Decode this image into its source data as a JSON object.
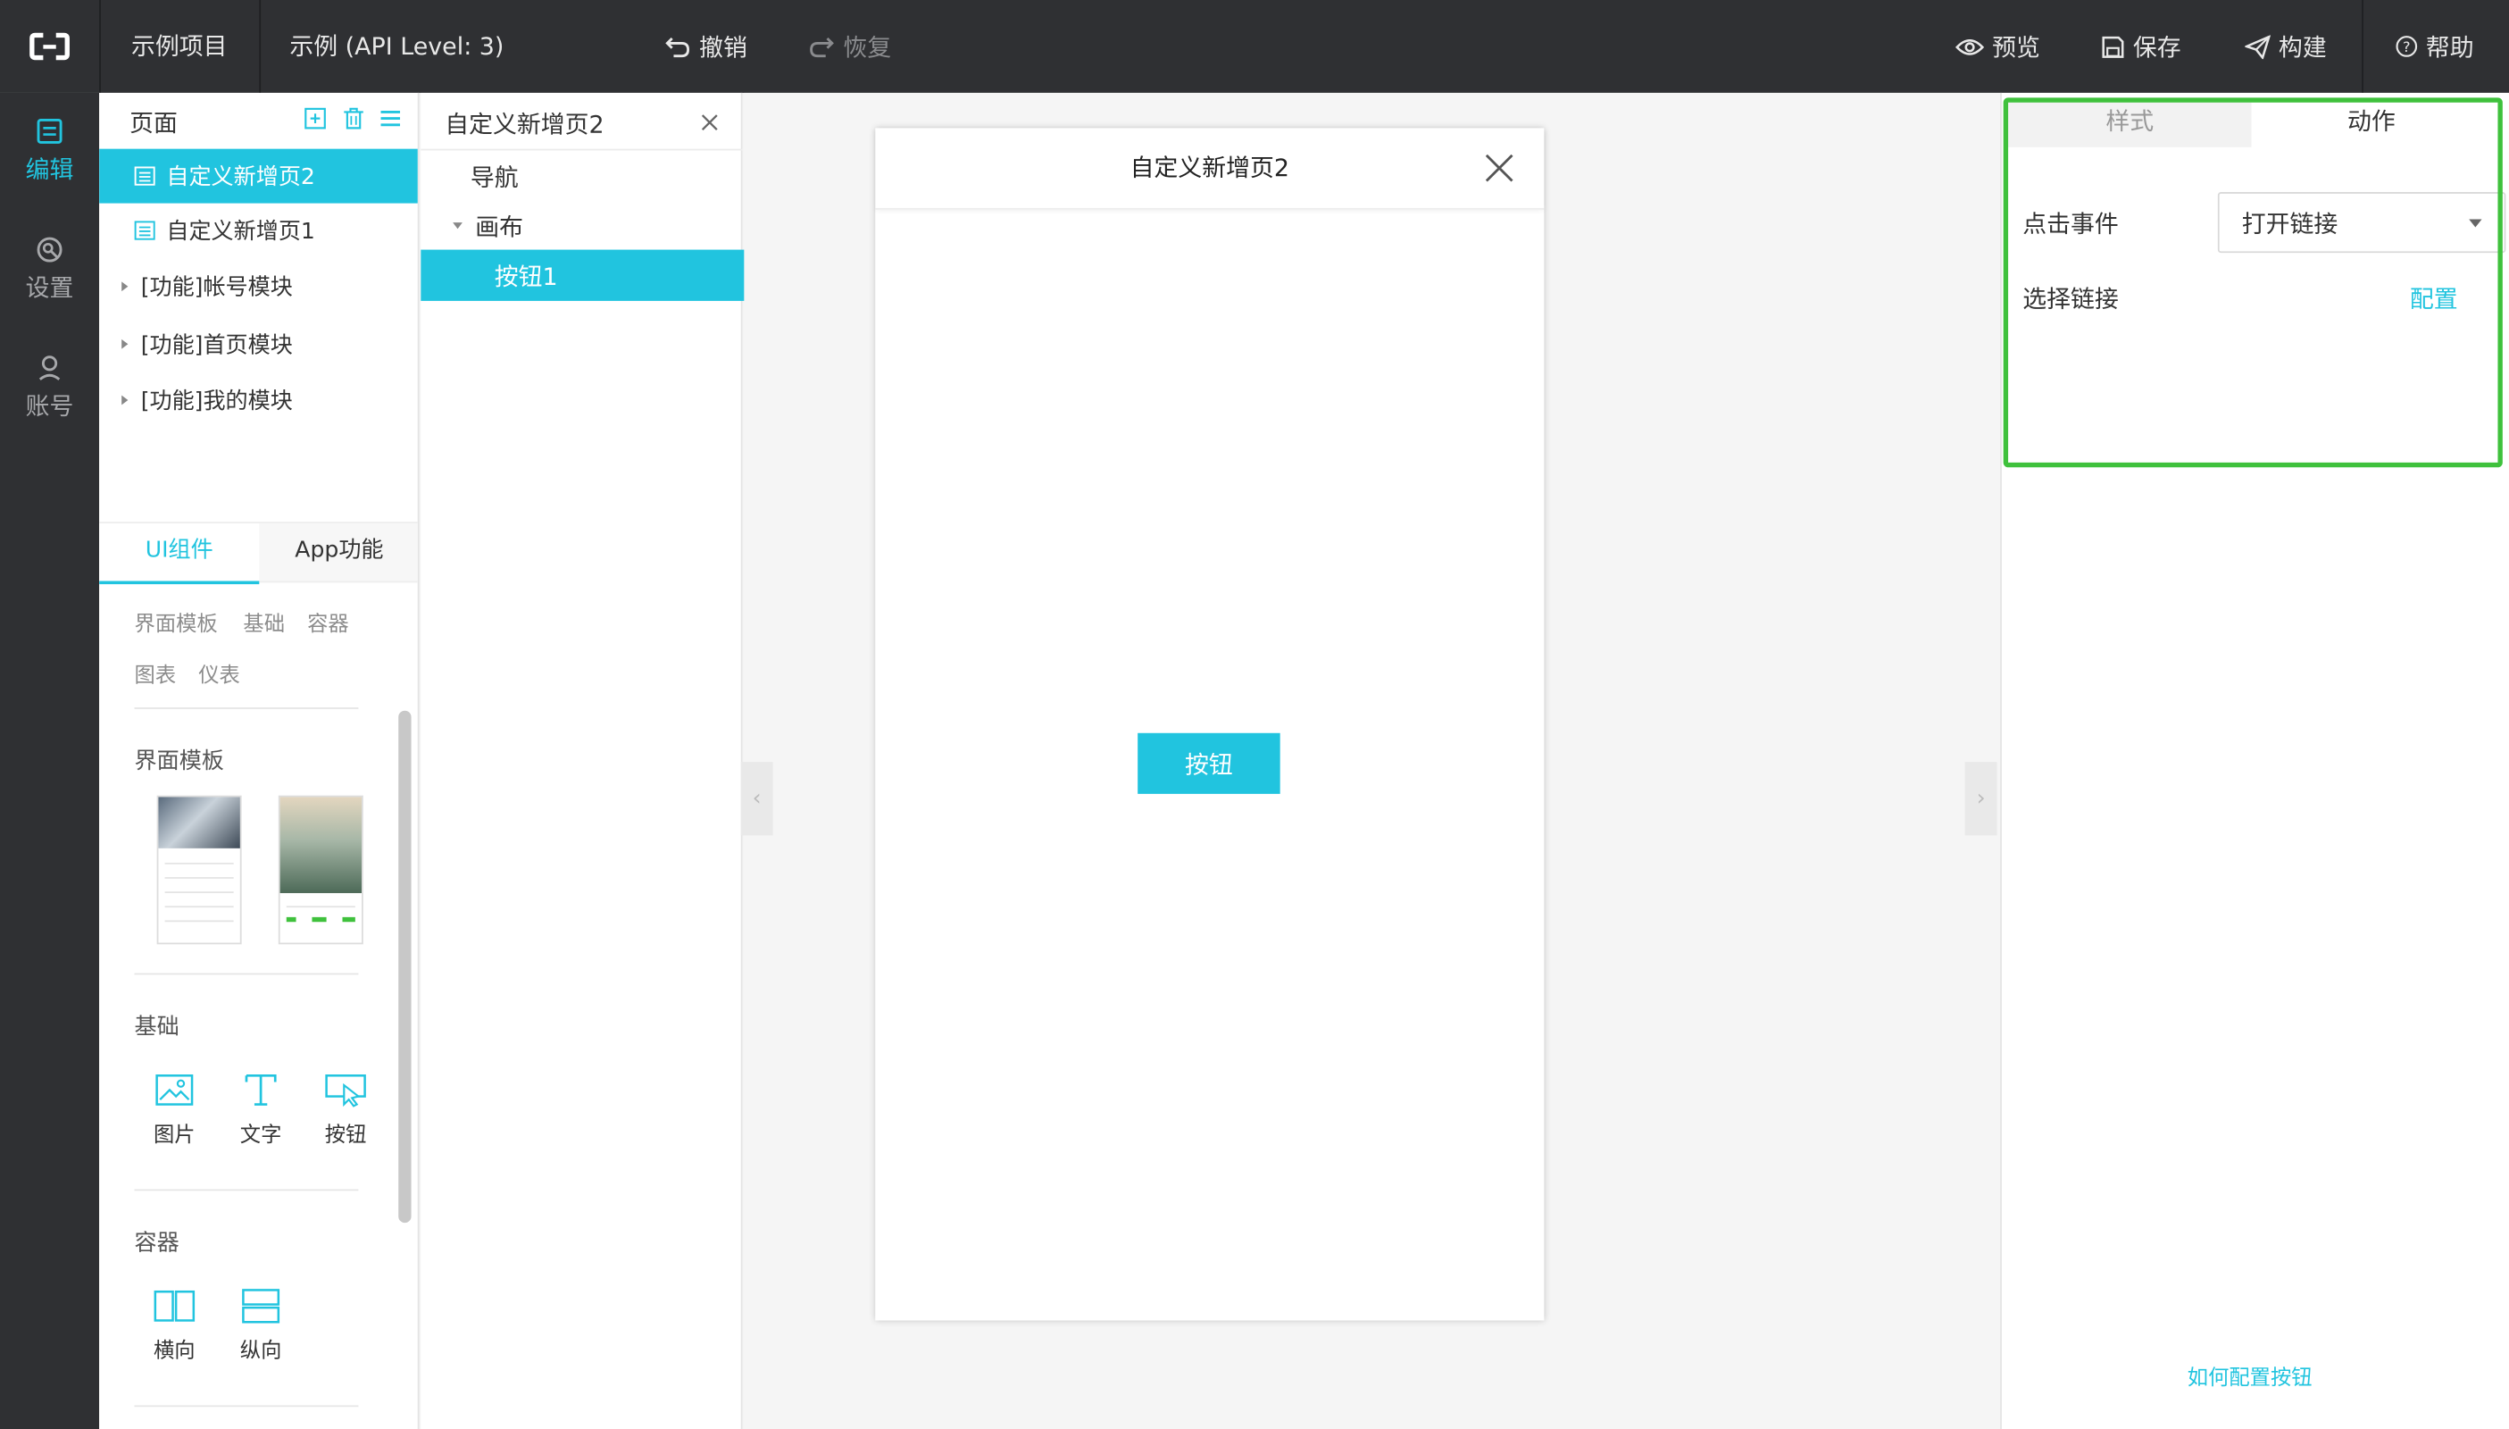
{
  "topbar": {
    "project": "示例项目",
    "app": "示例 (API Level: 3)",
    "undo": "撤销",
    "redo": "恢复",
    "preview": "预览",
    "save": "保存",
    "build": "构建",
    "help": "帮助"
  },
  "nav": {
    "edit": "编辑",
    "settings": "设置",
    "account": "账号"
  },
  "pages": {
    "title": "页面",
    "items": [
      {
        "label": "自定义新增页2"
      },
      {
        "label": "自定义新增页1"
      },
      {
        "label": "[功能]帐号模块"
      },
      {
        "label": "[功能]首页模块"
      },
      {
        "label": "[功能]我的模块"
      }
    ]
  },
  "palette": {
    "tabs": [
      "UI组件",
      "App功能"
    ],
    "categories": [
      "界面模板",
      "基础",
      "容器",
      "图表",
      "仪表"
    ],
    "sections": {
      "templates": "界面模板",
      "basic": "基础",
      "container": "容器"
    },
    "basic_items": [
      "图片",
      "文字",
      "按钮"
    ],
    "container_items": [
      "横向",
      "纵向"
    ]
  },
  "tree": {
    "title": "自定义新增页2",
    "nodes": [
      "导航",
      "画布",
      "按钮1"
    ]
  },
  "phone": {
    "title": "自定义新增页2",
    "button": "按钮"
  },
  "props": {
    "tabs": [
      "样式",
      "动作"
    ],
    "event_label": "点击事件",
    "event_value": "打开链接",
    "link_label": "选择链接",
    "link_action": "配置",
    "help_link": "如何配置按钮"
  },
  "colors": {
    "accent": "#21c4df",
    "topbar": "#2f3033",
    "highlight": "#3fc13c"
  }
}
